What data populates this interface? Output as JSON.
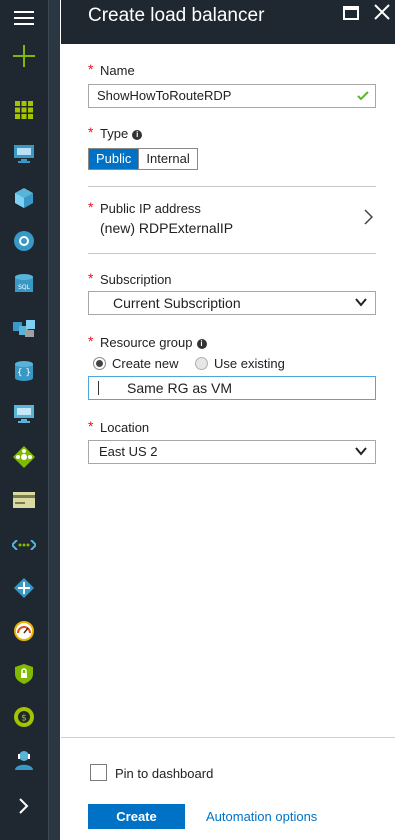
{
  "header": {
    "title": "Create load balancer"
  },
  "form": {
    "name": {
      "label": "Name",
      "value": "ShowHowToRouteRDP"
    },
    "type": {
      "label": "Type",
      "options": [
        "Public",
        "Internal"
      ],
      "selected": "Public"
    },
    "public_ip": {
      "label": "Public IP address",
      "value": "(new) RDPExternalIP"
    },
    "subscription": {
      "label": "Subscription",
      "value": "Current Subscription"
    },
    "resource_group": {
      "label": "Resource group",
      "option_create": "Create new",
      "option_existing": "Use existing",
      "selected": "Create new",
      "value": "Same RG as VM"
    },
    "location": {
      "label": "Location",
      "value": "East US 2"
    }
  },
  "footer": {
    "pin_label": "Pin to dashboard",
    "create_label": "Create",
    "automation_label": "Automation options"
  },
  "sidebar": {
    "items": [
      "hamburger-menu-icon",
      "new-plus-icon",
      "dashboard-grid-icon",
      "virtual-machines-icon",
      "cloud-services-icon",
      "app-services-icon",
      "sql-databases-icon",
      "resource-groups-icon",
      "storage-accounts-icon",
      "virtual-machine-classic-icon",
      "load-balancers-icon",
      "subscriptions-icon",
      "virtual-networks-icon",
      "vpn-gateway-icon",
      "monitor-icon",
      "security-center-icon",
      "cost-management-icon",
      "help-support-icon",
      "more-services-icon"
    ]
  },
  "colors": {
    "accent": "#0072c6",
    "rail": "#1f2830",
    "required": "#e81123",
    "valid": "#5fb530"
  }
}
